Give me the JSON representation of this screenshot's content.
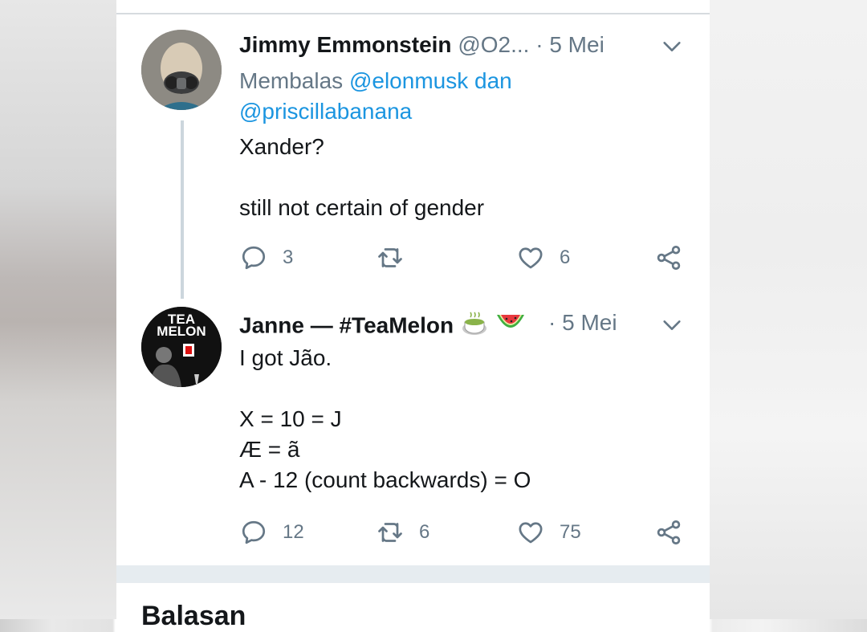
{
  "tweets": [
    {
      "name": "Jimmy Emmonstein",
      "handle": "@O2...",
      "separator": "·",
      "date": "5 Mei",
      "reply_prefix": "Membalas",
      "reply_user1": "@elonmusk",
      "reply_join": "dan",
      "reply_user2": "@priscillabanana",
      "text": "Xander?\n\nstill not certain of gender",
      "replies": "3",
      "retweets": "",
      "likes": "6"
    },
    {
      "name": "Janne — #TeaMelon",
      "separator": "·",
      "date": "5 Mei",
      "avatar_text_top": "TEA",
      "avatar_text_bottom": "MELON",
      "emojis": [
        "tea-cup-emoji",
        "watermelon-emoji"
      ],
      "text": "I got Jão.\n\nX = 10 = J\nÆ = ã\nA - 12 (count backwards) = O",
      "replies": "12",
      "retweets": "6",
      "likes": "75"
    }
  ],
  "section": {
    "title": "Balasan"
  },
  "icons": [
    "reply-icon",
    "retweet-icon",
    "like-icon",
    "share-icon",
    "chevron-down-icon"
  ],
  "colors": {
    "link": "#1b95e0",
    "muted": "#657786",
    "text": "#14171a",
    "divider": "#e6ecf0"
  }
}
